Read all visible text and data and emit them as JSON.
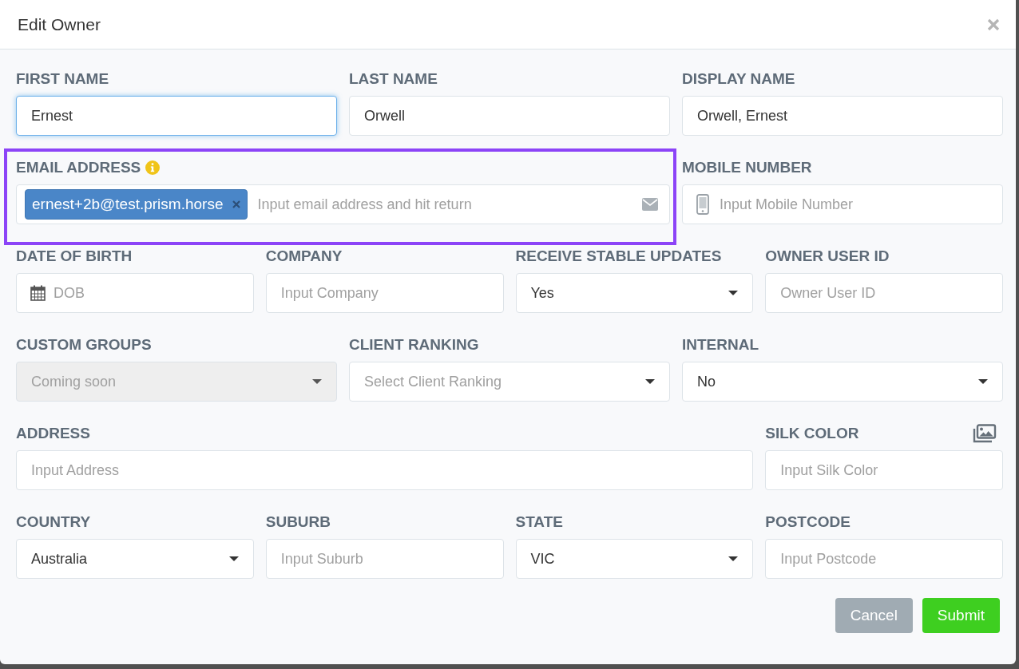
{
  "dialog": {
    "title": "Edit Owner"
  },
  "rows": [
    {
      "fields": [
        {
          "label": "FIRST NAME",
          "kind": "text",
          "value": "Ernest",
          "focused": true
        },
        {
          "label": "LAST NAME",
          "kind": "text",
          "value": "Orwell",
          "focused": false
        },
        {
          "label": "DISPLAY NAME",
          "kind": "text",
          "value": "Orwell, Ernest",
          "focused": false
        }
      ]
    },
    {
      "fields": [
        {
          "label": "EMAIL ADDRESS",
          "kind": "tags",
          "tags": [
            "ernest+2b@test.prism.horse"
          ],
          "placeholder": "Input email address and hit return",
          "highlighted": true
        },
        {
          "label": "MOBILE NUMBER",
          "kind": "text",
          "placeholder": "Input Mobile Number",
          "focused": false
        }
      ]
    },
    {
      "fields": [
        {
          "label": "DATE OF BIRTH",
          "kind": "text",
          "placeholder": "DOB",
          "focused": false
        },
        {
          "label": "COMPANY",
          "kind": "text",
          "placeholder": "Input Company",
          "focused": false
        },
        {
          "label": "RECEIVE STABLE UPDATES",
          "kind": "select",
          "value": "Yes",
          "disabled": false
        },
        {
          "label": "OWNER USER ID",
          "kind": "text",
          "placeholder": "Owner User ID",
          "focused": false
        }
      ]
    },
    {
      "fields": [
        {
          "label": "CUSTOM GROUPS",
          "kind": "select",
          "placeholder": "Coming soon",
          "disabled": true
        },
        {
          "label": "CLIENT RANKING",
          "kind": "select",
          "placeholder": "Select Client Ranking",
          "disabled": false
        },
        {
          "label": "INTERNAL",
          "kind": "select",
          "value": "No",
          "disabled": false
        }
      ]
    },
    {
      "fields": [
        {
          "label": "ADDRESS",
          "kind": "text",
          "placeholder": "Input Address",
          "focused": false
        },
        {
          "label": "SILK COLOR",
          "kind": "text",
          "placeholder": "Input Silk Color",
          "focused": false
        }
      ]
    },
    {
      "fields": [
        {
          "label": "COUNTRY",
          "kind": "select",
          "value": "Australia",
          "disabled": false
        },
        {
          "label": "SUBURB",
          "kind": "text",
          "placeholder": "Input Suburb",
          "focused": false
        },
        {
          "label": "STATE",
          "kind": "select",
          "value": "VIC",
          "disabled": false
        },
        {
          "label": "POSTCODE",
          "kind": "text",
          "placeholder": "Input Postcode",
          "focused": false
        }
      ]
    }
  ],
  "buttons": [
    {
      "label": "Cancel",
      "kind": "secondary"
    },
    {
      "label": "Submit",
      "kind": "primary"
    }
  ]
}
